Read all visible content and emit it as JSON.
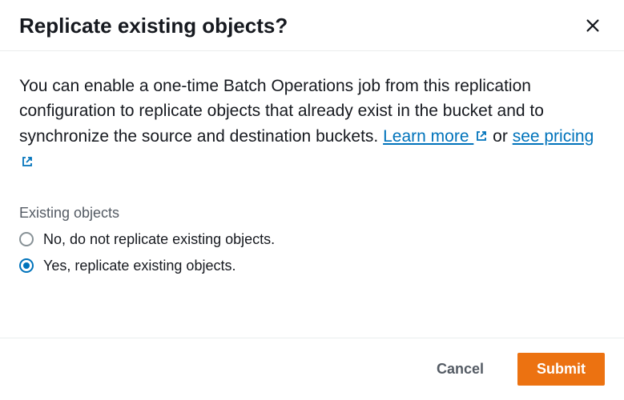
{
  "header": {
    "title": "Replicate existing objects?"
  },
  "body": {
    "desc_part1": "You can enable a one-time Batch Operations job from this replication configuration to replicate objects that already exist in the bucket and to synchronize the source and destination buckets. ",
    "learn_more": "Learn more ",
    "desc_part2": " or ",
    "see_pricing": "see pricing ",
    "section_label": "Existing objects",
    "options": {
      "no": "No, do not replicate existing objects.",
      "yes": "Yes, replicate existing objects."
    },
    "selected": "yes"
  },
  "footer": {
    "cancel": "Cancel",
    "submit": "Submit"
  },
  "colors": {
    "link": "#0073bb",
    "primary_button": "#ec7211"
  }
}
